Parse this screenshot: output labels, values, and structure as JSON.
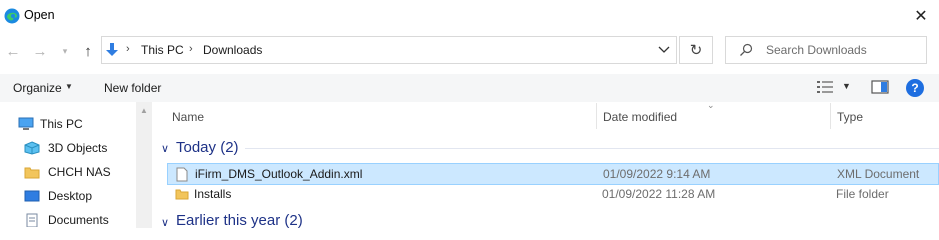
{
  "window": {
    "title": "Open",
    "app_icon": "edge-browser-icon"
  },
  "address": {
    "breadcrumb": [
      "This PC",
      "Downloads"
    ],
    "location_icon": "downloads-arrow-icon"
  },
  "search": {
    "placeholder": "Search Downloads"
  },
  "toolbar": {
    "organize_label": "Organize",
    "new_folder_label": "New folder",
    "help_label": "?"
  },
  "nav_pane": {
    "items": [
      {
        "label": "This PC",
        "icon": "this-pc-icon"
      },
      {
        "label": "3D Objects",
        "icon": "3d-objects-icon"
      },
      {
        "label": "CHCH NAS",
        "icon": "folder-icon"
      },
      {
        "label": "Desktop",
        "icon": "desktop-icon"
      },
      {
        "label": "Documents",
        "icon": "documents-icon"
      }
    ]
  },
  "columns": {
    "name": "Name",
    "date_modified": "Date modified",
    "type": "Type"
  },
  "groups": [
    {
      "header": "Today (2)",
      "files": [
        {
          "name": "iFirm_DMS_Outlook_Addin.xml",
          "date_modified": "01/09/2022 9:14 AM",
          "type": "XML Document",
          "icon": "file-icon",
          "selected": true
        },
        {
          "name": "Installs",
          "date_modified": "01/09/2022 11:28 AM",
          "type": "File folder",
          "icon": "folder-icon",
          "selected": false
        }
      ]
    },
    {
      "header": "Earlier this year (2)",
      "files": []
    }
  ],
  "colors": {
    "selection": "#cce8ff",
    "selection_border": "#99d1ff",
    "group_header": "#1e3287",
    "accent": "#1e6ee0"
  }
}
